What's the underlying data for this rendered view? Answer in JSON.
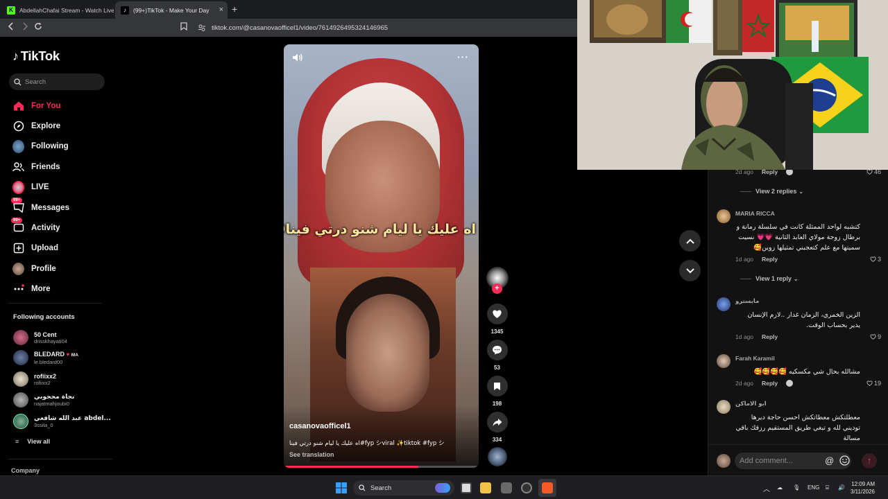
{
  "browser": {
    "tabs": [
      {
        "title": "AbdellahChafai Stream - Watch Live"
      },
      {
        "title": "(99+)TikTok - Make Your Day"
      }
    ],
    "new_tab": "+",
    "close_glyph": "×",
    "url": "tiktok.com/@casanovaofficel1/video/7614926495324146965"
  },
  "brand": {
    "name": "TikTok",
    "accent": "#fe2c55"
  },
  "search": {
    "placeholder": "Search"
  },
  "nav": [
    {
      "label": "For You",
      "icon": "home-icon",
      "active": true
    },
    {
      "label": "Explore",
      "icon": "compass-icon"
    },
    {
      "label": "Following",
      "icon": "following-avatar-icon"
    },
    {
      "label": "Friends",
      "icon": "friends-icon"
    },
    {
      "label": "LIVE",
      "icon": "live-icon"
    },
    {
      "label": "Messages",
      "icon": "messages-icon",
      "badge": "99+"
    },
    {
      "label": "Activity",
      "icon": "activity-icon",
      "badge": "99+"
    },
    {
      "label": "Upload",
      "icon": "upload-icon"
    },
    {
      "label": "Profile",
      "icon": "profile-icon"
    },
    {
      "label": "More",
      "icon": "more-icon"
    }
  ],
  "following_accounts": {
    "title": "Following accounts",
    "accounts": [
      {
        "name": "50 Cent",
        "username": "drisskhayati04"
      },
      {
        "name": "BLEDARD",
        "badge": "MA",
        "username": "le.bledard00"
      },
      {
        "name": "rofiixx2",
        "username": "rofiixx2"
      },
      {
        "name": "نجاة محجوبي",
        "username": "najatmahjoubi0"
      },
      {
        "name": "عبد الله شافعي abdel...",
        "username": "3ssila_0"
      }
    ],
    "view_all": "View all"
  },
  "company_label": "Company",
  "video": {
    "caption_overlay": "اه عليك يا ليام شنو درتي فينا😟",
    "author": "casanovaofficel1",
    "description": "اه عليك يا ليام شنو درتي فينا#fyp シviral ✨tiktok #fyp シ",
    "see_translation": "See translation",
    "progress": 0.69,
    "more": "···"
  },
  "actions": {
    "likes": "1345",
    "comments": "53",
    "saves": "198",
    "shares": "334"
  },
  "comments": [
    {
      "meta_time": "2d ago",
      "reply": "Reply",
      "likes": "46",
      "view_replies": "View 2 replies"
    },
    {
      "name": "MARIA RICCA",
      "text": "كتشبه لواحد الممثلة كانت في سلسلة رمانة و برطال زوجة مولاي العابد الثانية 💗💗 نسيت سميتها مع علم كتعجبني تمثيلها زوين🥰",
      "time": "1d ago",
      "reply": "Reply",
      "likes": "3",
      "view_replies": "View 1 reply"
    },
    {
      "name": "مايسترو",
      "text": "الزين الخمري، الزمان غدار ..لازم الإنسان يدير بحساب الوقت.",
      "time": "1d ago",
      "reply": "Reply",
      "likes": "9"
    },
    {
      "name": "Farah Karamil",
      "text": "مشالله بحال شي مكسكيه 🥰🥰🥰🥰",
      "time": "2d ago",
      "reply": "Reply",
      "likes": "19"
    },
    {
      "name": "ابو الاماكن",
      "text": "معطلتكش معطاتكش احسن حاجة ديرها توديني لله و تبغي طريق المستقيم رزقك باقي مسالة"
    }
  ],
  "comment_input": {
    "placeholder": "Add comment..."
  },
  "taskbar": {
    "search": "Search",
    "lang": "ENG",
    "time": "12:09 AM",
    "date": "3/11/2026"
  }
}
